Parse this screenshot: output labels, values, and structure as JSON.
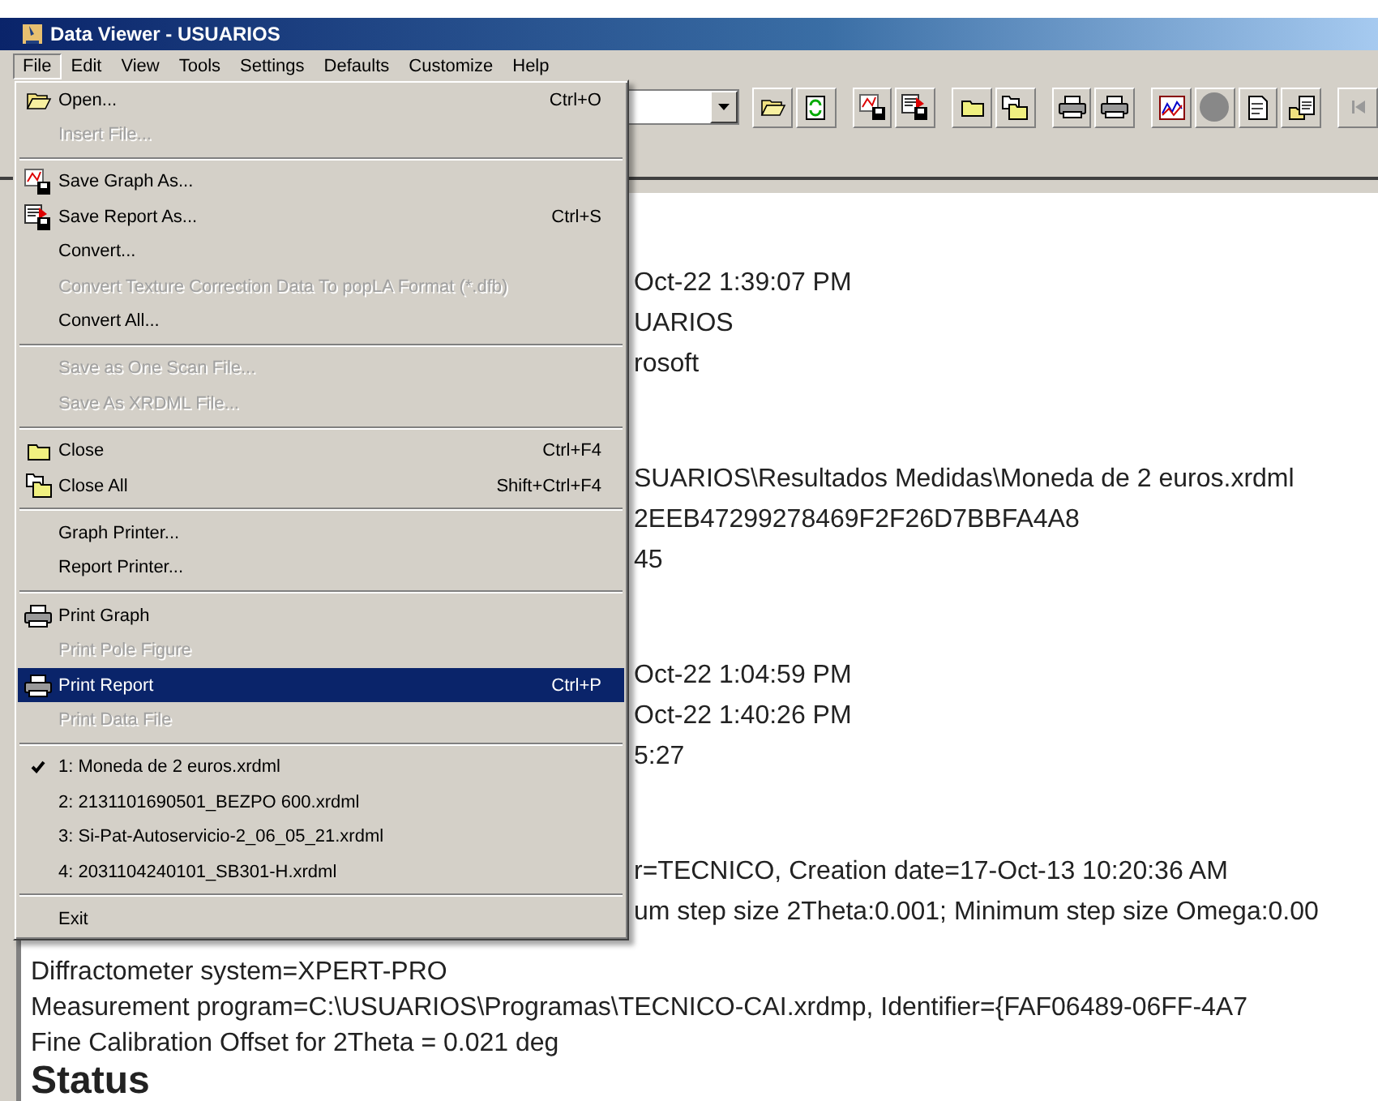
{
  "window": {
    "title": "Data Viewer - USUARIOS"
  },
  "menu_bar": [
    {
      "label": "File",
      "selected": true
    },
    {
      "label": "Edit",
      "selected": false
    },
    {
      "label": "View",
      "selected": false
    },
    {
      "label": "Tools",
      "selected": false
    },
    {
      "label": "Settings",
      "selected": false
    },
    {
      "label": "Defaults",
      "selected": false
    },
    {
      "label": "Customize",
      "selected": false
    },
    {
      "label": "Help",
      "selected": false
    }
  ],
  "file_menu": {
    "items": [
      {
        "kind": "item",
        "label": "Open...",
        "shortcut": "Ctrl+O",
        "disabled": false,
        "selected": false,
        "checked": false
      },
      {
        "kind": "item",
        "label": "Insert File...",
        "disabled": true,
        "selected": false,
        "checked": false
      },
      {
        "kind": "separator"
      },
      {
        "kind": "item",
        "label": "Save Graph As...",
        "disabled": false,
        "selected": false,
        "checked": false
      },
      {
        "kind": "item",
        "label": "Save Report As...",
        "shortcut": "Ctrl+S",
        "disabled": false,
        "selected": false,
        "checked": false
      },
      {
        "kind": "item",
        "label": "Convert...",
        "disabled": false,
        "selected": false,
        "checked": false
      },
      {
        "kind": "item",
        "label": "Convert Texture Correction Data To popLA Format (*.dfb)",
        "disabled": true,
        "selected": false,
        "checked": false
      },
      {
        "kind": "item",
        "label": "Convert All...",
        "disabled": false,
        "selected": false,
        "checked": false
      },
      {
        "kind": "separator"
      },
      {
        "kind": "item",
        "label": "Save as One Scan File...",
        "disabled": true,
        "selected": false,
        "checked": false
      },
      {
        "kind": "item",
        "label": "Save As XRDML File...",
        "disabled": true,
        "selected": false,
        "checked": false
      },
      {
        "kind": "separator"
      },
      {
        "kind": "item",
        "label": "Close",
        "shortcut": "Ctrl+F4",
        "disabled": false,
        "selected": false,
        "checked": false
      },
      {
        "kind": "item",
        "label": "Close All",
        "shortcut": "Shift+Ctrl+F4",
        "disabled": false,
        "selected": false,
        "checked": false
      },
      {
        "kind": "separator"
      },
      {
        "kind": "item",
        "label": "Graph Printer...",
        "disabled": false,
        "selected": false,
        "checked": false
      },
      {
        "kind": "item",
        "label": "Report Printer...",
        "disabled": false,
        "selected": false,
        "checked": false
      },
      {
        "kind": "separator"
      },
      {
        "kind": "item",
        "label": "Print Graph",
        "disabled": false,
        "selected": false,
        "checked": false
      },
      {
        "kind": "item",
        "label": "Print Pole Figure",
        "disabled": true,
        "selected": false,
        "checked": false
      },
      {
        "kind": "item",
        "label": "Print Report",
        "shortcut": "Ctrl+P",
        "disabled": false,
        "selected": true,
        "checked": false
      },
      {
        "kind": "item",
        "label": "Print Data File",
        "disabled": true,
        "selected": false,
        "checked": false
      },
      {
        "kind": "separator"
      },
      {
        "kind": "item",
        "label": "1: Moneda de 2 euros.xrdml",
        "disabled": false,
        "selected": false,
        "checked": true
      },
      {
        "kind": "item",
        "label": "2: 2131101690501_BEZPO 600.xrdml",
        "disabled": false,
        "selected": false,
        "checked": false
      },
      {
        "kind": "item",
        "label": "3: Si-Pat-Autoservicio-2_06_05_21.xrdml",
        "disabled": false,
        "selected": false,
        "checked": false
      },
      {
        "kind": "item",
        "label": "4: 2031104240101_SB301-H.xrdml",
        "disabled": false,
        "selected": false,
        "checked": false
      },
      {
        "kind": "separator"
      },
      {
        "kind": "item",
        "label": "Exit",
        "disabled": false,
        "selected": false,
        "checked": false
      }
    ]
  },
  "report": {
    "visible_fragments": [
      {
        "lines": [
          "Oct-22 1:39:07 PM",
          "UARIOS",
          "rosoft"
        ]
      },
      {
        "lines": [
          "SUARIOS\\Resultados Medidas\\Moneda de 2 euros.xrdml",
          "2EEB47299278469F2F26D7BBFA4A8",
          "45"
        ]
      },
      {
        "lines": [
          "Oct-22 1:04:59 PM",
          "Oct-22 1:40:26 PM",
          "5:27"
        ]
      },
      {
        "lines": [
          "r=TECNICO, Creation date=17-Oct-13 10:20:36 AM",
          "um step size 2Theta:0.001; Minimum step size Omega:0.00"
        ]
      }
    ],
    "lines": [
      "Diffractometer system=XPERT-PRO",
      "Measurement program=C:\\USUARIOS\\Programas\\TECNICO-CAI.xrdmp, Identifier={FAF06489-06FF-4A7",
      "Fine Calibration Offset for 2Theta = 0.021 deg"
    ],
    "heading": "Status"
  }
}
